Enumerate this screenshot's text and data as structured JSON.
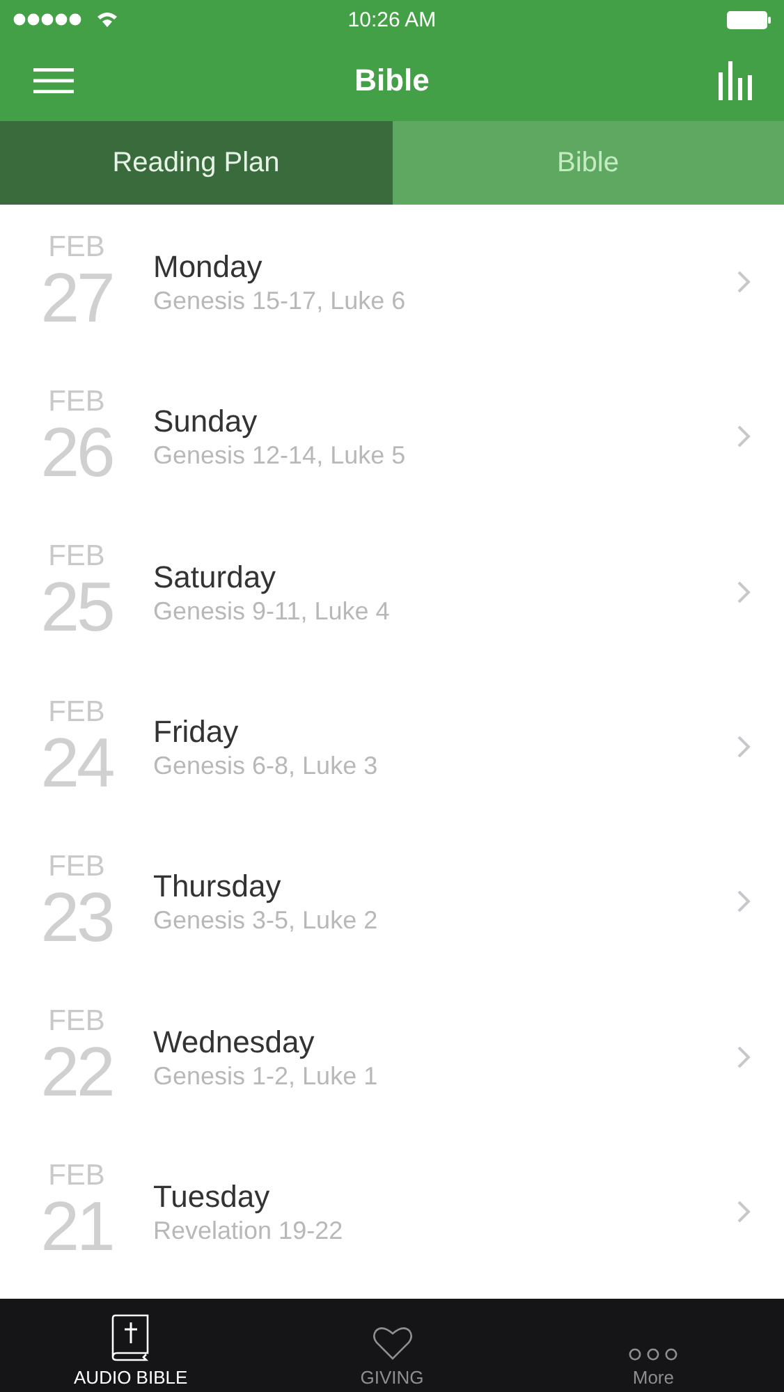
{
  "status_bar": {
    "time": "10:26 AM"
  },
  "nav": {
    "title": "Bible"
  },
  "tabs": [
    {
      "label": "Reading Plan",
      "selected": true
    },
    {
      "label": "Bible",
      "selected": false
    }
  ],
  "readings": [
    {
      "month": "FEB",
      "day": "27",
      "weekday": "Monday",
      "passages": "Genesis 15-17, Luke 6"
    },
    {
      "month": "FEB",
      "day": "26",
      "weekday": "Sunday",
      "passages": "Genesis 12-14, Luke 5"
    },
    {
      "month": "FEB",
      "day": "25",
      "weekday": "Saturday",
      "passages": "Genesis 9-11, Luke 4"
    },
    {
      "month": "FEB",
      "day": "24",
      "weekday": "Friday",
      "passages": "Genesis 6-8, Luke 3"
    },
    {
      "month": "FEB",
      "day": "23",
      "weekday": "Thursday",
      "passages": "Genesis 3-5, Luke 2"
    },
    {
      "month": "FEB",
      "day": "22",
      "weekday": "Wednesday",
      "passages": "Genesis 1-2, Luke 1"
    },
    {
      "month": "FEB",
      "day": "21",
      "weekday": "Tuesday",
      "passages": "Revelation 19-22"
    }
  ],
  "tab_bar": [
    {
      "label": "AUDIO BIBLE",
      "kind": "book",
      "selected": true
    },
    {
      "label": "GIVING",
      "kind": "heart",
      "selected": false
    },
    {
      "label": "More",
      "kind": "more",
      "selected": false
    }
  ]
}
